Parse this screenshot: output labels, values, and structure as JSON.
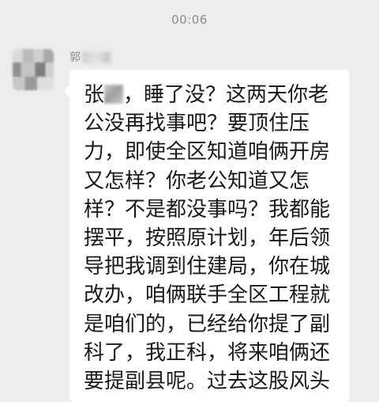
{
  "status": {
    "time": "00:06"
  },
  "chat": {
    "sender_name_visible": "郭",
    "message": {
      "line_1_before_redaction": "张",
      "line_1_after_redaction": "，睡了没？这两天你老",
      "lines": [
        "公没再找事吧？要顶住压",
        "力，即使全区知道咱俩开房",
        "又怎样？你老公知道又怎",
        "样？不是都没事吗？我都能",
        "摆平，按照原计划，年后领",
        "导把我调到住建局，你在城",
        "改办，咱俩联手全区工程就",
        "是咱们的，已经给你提了副",
        "科了，我正科，将来咱俩还",
        "要提副县呢。过去这股风头"
      ]
    }
  }
}
